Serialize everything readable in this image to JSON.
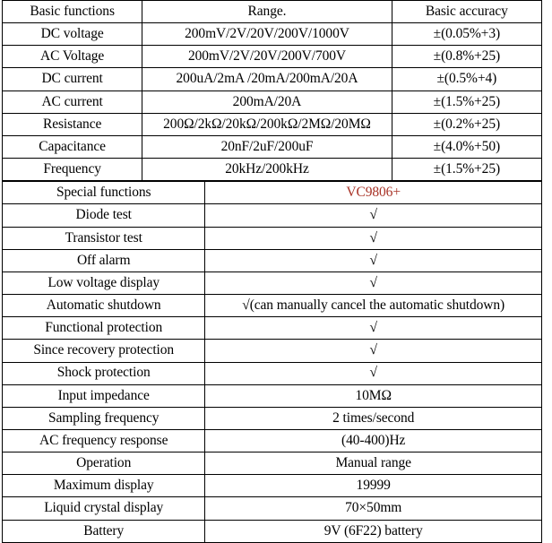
{
  "table": {
    "accent_color": "#a83226",
    "check_symbol": "√",
    "section_basic": {
      "headers": {
        "function": "Basic functions",
        "range": "Range.",
        "accuracy": "Basic accuracy"
      },
      "rows": [
        {
          "function": "DC voltage",
          "range": "200mV/2V/20V/200V/1000V",
          "accuracy": "±(0.05%+3)"
        },
        {
          "function": "AC Voltage",
          "range": "200mV/2V/20V/200V/700V",
          "accuracy": "±(0.8%+25)"
        },
        {
          "function": "DC current",
          "range": "200uA/2mA /20mA/200mA/20A",
          "accuracy": "±(0.5%+4)"
        },
        {
          "function": "AC current",
          "range": "200mA/20A",
          "accuracy": "±(1.5%+25)"
        },
        {
          "function": "Resistance",
          "range": "200Ω/2kΩ/20kΩ/200kΩ/2MΩ/20MΩ",
          "accuracy": "±(0.2%+25)"
        },
        {
          "function": "Capacitance",
          "range": "20nF/2uF/200uF",
          "accuracy": "±(4.0%+50)"
        },
        {
          "function": "Frequency",
          "range": "20kHz/200kHz",
          "accuracy": "±(1.5%+25)"
        }
      ]
    },
    "section_special": {
      "header": {
        "label": "Special functions",
        "model": "VC9806+"
      },
      "rows": [
        {
          "label": "Diode test",
          "value": "√",
          "align": "center"
        },
        {
          "label": "Transistor test",
          "value": "√",
          "align": "center"
        },
        {
          "label": "Off alarm",
          "value": "√",
          "align": "center"
        },
        {
          "label": "Low voltage display",
          "value": "√",
          "align": "center"
        },
        {
          "label": "Automatic shutdown",
          "value": "√(can manually cancel the automatic shutdown)",
          "align": "left"
        },
        {
          "label": "Functional protection",
          "value": "√",
          "align": "center"
        },
        {
          "label": "Since recovery protection",
          "value": "√",
          "align": "center"
        },
        {
          "label": "Shock protection",
          "value": "√",
          "align": "center"
        },
        {
          "label": "Input impedance",
          "value": "10MΩ",
          "align": "center"
        },
        {
          "label": "Sampling frequency",
          "value": "2 times/second",
          "align": "center"
        },
        {
          "label": "AC frequency response",
          "value": "(40-400)Hz",
          "align": "center"
        },
        {
          "label": "Operation",
          "value": "Manual range",
          "align": "center"
        },
        {
          "label": "Maximum display",
          "value": "19999",
          "align": "center"
        },
        {
          "label": "Liquid crystal display",
          "value": "70×50mm",
          "align": "center"
        },
        {
          "label": "Battery",
          "value": "9V (6F22) battery",
          "align": "center"
        }
      ]
    }
  }
}
